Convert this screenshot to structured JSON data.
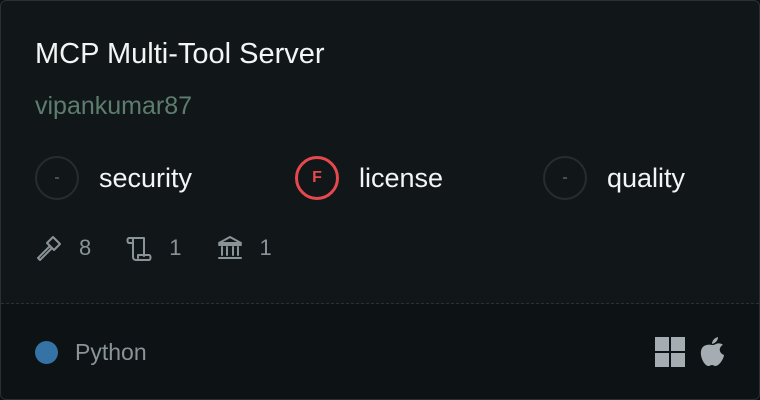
{
  "server": {
    "title": "MCP Multi-Tool Server",
    "author": "vipankumar87"
  },
  "scores": [
    {
      "grade": "-",
      "label": "security",
      "status": "none"
    },
    {
      "grade": "F",
      "label": "license",
      "status": "fail",
      "color": "#e5484d"
    },
    {
      "grade": "-",
      "label": "quality",
      "status": "none"
    }
  ],
  "stats": {
    "tools": {
      "icon": "hammer-icon",
      "value": "8"
    },
    "prompts": {
      "icon": "scroll-icon",
      "value": "1"
    },
    "resources": {
      "icon": "bank-icon",
      "value": "1"
    }
  },
  "footer": {
    "language": "Python",
    "language_color": "#3572a5",
    "platforms": [
      "windows-icon",
      "apple-icon"
    ]
  }
}
